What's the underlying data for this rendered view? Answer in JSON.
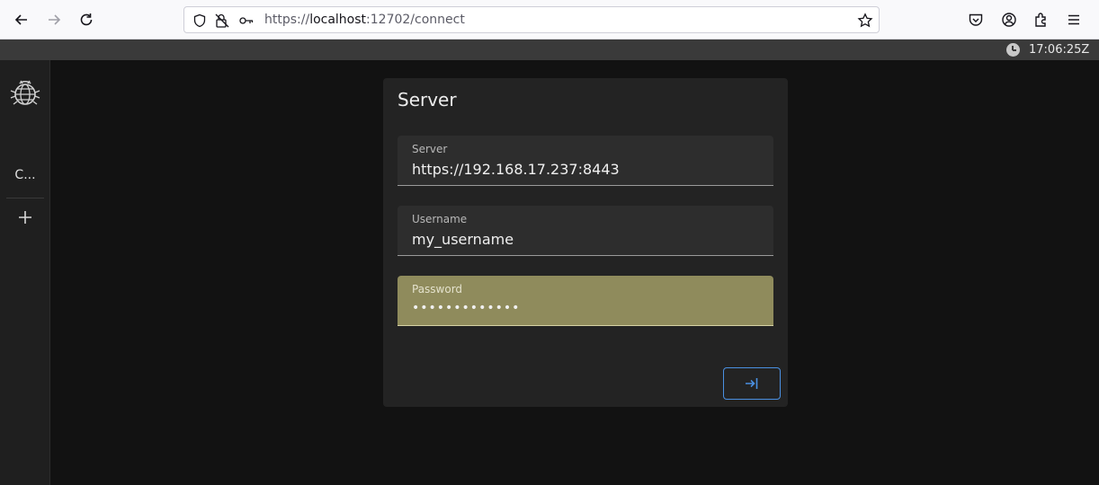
{
  "browser": {
    "url_prefix": "https://",
    "url_host": "localhost",
    "url_rest": ":12702/connect"
  },
  "header": {
    "time": "17:06:25Z"
  },
  "sidebar": {
    "connection_label": "C...",
    "add_icon": "plus-icon",
    "logo_icon": "bug-globe-logo"
  },
  "card": {
    "title": "Server",
    "fields": [
      {
        "label": "Server",
        "value": "https://192.168.17.237:8443"
      },
      {
        "label": "Username",
        "value": "my_username"
      },
      {
        "label": "Password",
        "value": "•••••••••••••"
      }
    ],
    "login_icon": "login-icon"
  },
  "colors": {
    "accent": "#4a90e2",
    "password_highlight": "#8f8b5c",
    "background": "#121212",
    "card": "#232323"
  }
}
